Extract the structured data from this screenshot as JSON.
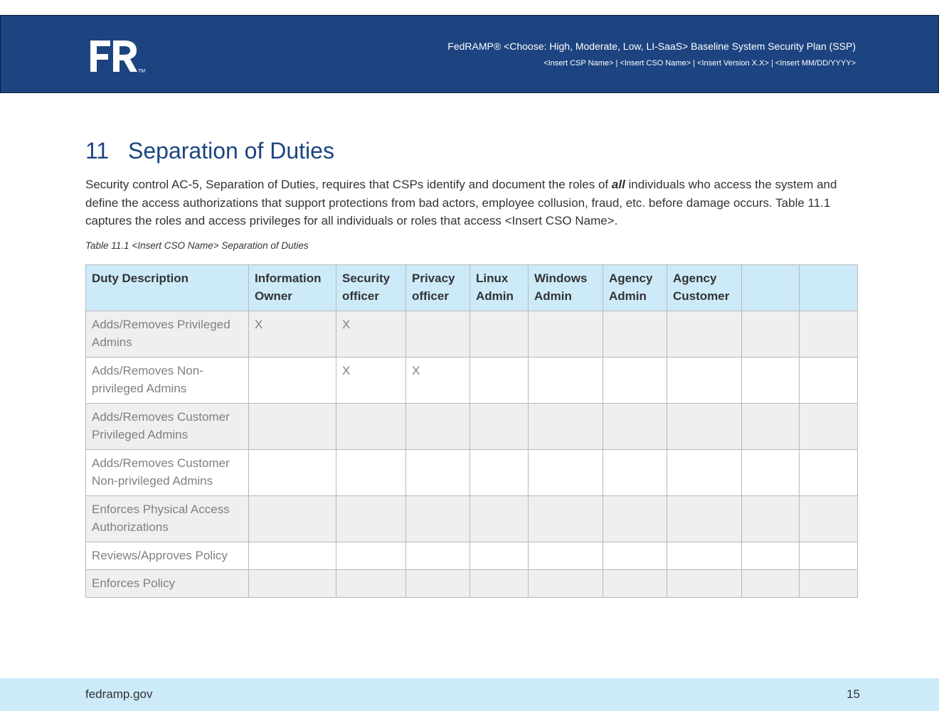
{
  "header": {
    "logo_text": "FR",
    "logo_tm": "TM",
    "title": "FedRAMP® <Choose: High, Moderate, Low, LI-SaaS> Baseline System Security Plan (SSP)",
    "subtitle": "<Insert CSP Name> | <Insert CSO Name> | <Insert Version X.X> | <Insert MM/DD/YYYY>"
  },
  "section": {
    "number": "11",
    "title": "Separation of Duties"
  },
  "intro": {
    "part1": "Security control AC-5, Separation of Duties, requires that CSPs identify and document the roles of ",
    "emphasis": "all",
    "part2": " individuals who access the system and define the access authorizations that support protections from bad actors, employee collusion, fraud, etc. before damage occurs. Table 11.1 captures the roles and access privileges for all individuals or roles that access <Insert CSO Name>."
  },
  "table": {
    "caption": "Table 11.1 <Insert CSO Name> Separation of Duties",
    "headers": [
      "Duty Description",
      "Information Owner",
      "Security officer",
      "Privacy officer",
      "Linux Admin",
      "Windows Admin",
      "Agency Admin",
      "Agency Customer",
      "",
      ""
    ],
    "rows": [
      [
        "Adds/Removes Privileged Admins",
        "X",
        "X",
        "",
        "",
        "",
        "",
        "",
        "",
        ""
      ],
      [
        "Adds/Removes Non-privileged Admins",
        "",
        "X",
        "X",
        "",
        "",
        "",
        "",
        "",
        ""
      ],
      [
        "Adds/Removes Customer Privileged Admins",
        "",
        "",
        "",
        "",
        "",
        "",
        "",
        "",
        ""
      ],
      [
        "Adds/Removes Customer Non-privileged Admins",
        "",
        "",
        "",
        "",
        "",
        "",
        "",
        "",
        ""
      ],
      [
        "Enforces Physical Access Authorizations",
        "",
        "",
        "",
        "",
        "",
        "",
        "",
        "",
        ""
      ],
      [
        "Reviews/Approves Policy",
        "",
        "",
        "",
        "",
        "",
        "",
        "",
        "",
        ""
      ],
      [
        "Enforces Policy",
        "",
        "",
        "",
        "",
        "",
        "",
        "",
        "",
        ""
      ]
    ]
  },
  "footer": {
    "site": "fedramp.gov",
    "page": "15"
  },
  "colors": {
    "header_bg": "#1d4480",
    "title_blue": "#1d4480",
    "table_header_bg": "#cdeaf9",
    "footer_bg": "#cdeaf9",
    "zebra_row": "#efefef"
  }
}
